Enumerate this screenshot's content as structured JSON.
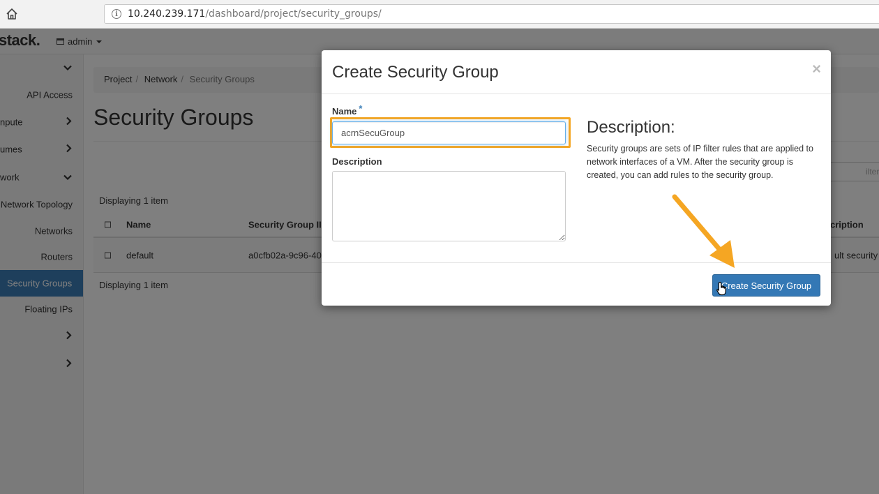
{
  "browser": {
    "url_host": "10.240.239.171",
    "url_path": "/dashboard/project/security_groups/"
  },
  "topnav": {
    "brand": "stack.",
    "project": "admin"
  },
  "sidebar": {
    "items": [
      {
        "label": ""
      },
      {
        "label": "API Access"
      },
      {
        "label": "npute"
      },
      {
        "label": "umes"
      },
      {
        "label": "work"
      },
      {
        "label": "Network Topology"
      },
      {
        "label": "Networks"
      },
      {
        "label": "Routers"
      },
      {
        "label": "Security Groups"
      },
      {
        "label": "Floating IPs"
      },
      {
        "label": ""
      },
      {
        "label": ""
      }
    ]
  },
  "breadcrumb": {
    "project": "Project",
    "network": "Network",
    "current": "Security Groups"
  },
  "page": {
    "title": "Security Groups",
    "filter_placeholder": "ilter",
    "display_count": "Displaying 1 item"
  },
  "table": {
    "columns": [
      "Name",
      "Security Group II",
      "cription"
    ],
    "rows": [
      {
        "name": "default",
        "id": "a0cfb02a-9c96-40c",
        "description": "ult security g"
      }
    ]
  },
  "modal": {
    "title": "Create Security Group",
    "close": "×",
    "name_label": "Name",
    "required_mark": "*",
    "name_value": "acrnSecuGroup",
    "description_label": "Description",
    "help_title": "Description:",
    "help_text": "Security groups are sets of IP filter rules that are applied to network interfaces of a VM. After the security group is created, you can add rules to the security group.",
    "submit_label": "Create Security Group"
  },
  "colors": {
    "primary": "#3478b5",
    "highlight": "#f5a623",
    "active_sidebar": "#3c7fb8"
  }
}
